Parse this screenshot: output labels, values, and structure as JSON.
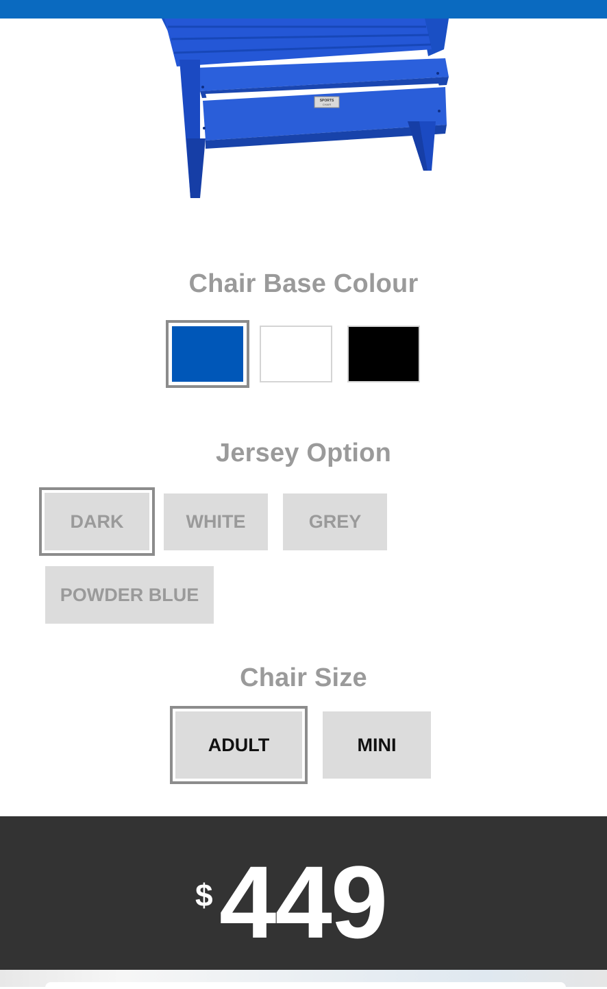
{
  "header": {
    "accent_color": "#0a6ac0"
  },
  "product_image": {
    "description": "blue-chair-image",
    "badge_text": "SPORTS CHAIR"
  },
  "base_colour": {
    "title": "Chair Base Colour",
    "options": [
      {
        "name": "blue",
        "color": "#0057b8",
        "selected": true
      },
      {
        "name": "white",
        "color": "#ffffff",
        "selected": false
      },
      {
        "name": "black",
        "color": "#000000",
        "selected": false
      }
    ]
  },
  "jersey": {
    "title": "Jersey Option",
    "options": [
      {
        "label": "DARK",
        "selected": true
      },
      {
        "label": "WHITE",
        "selected": false
      },
      {
        "label": "GREY",
        "selected": false
      },
      {
        "label": "POWDER BLUE",
        "selected": false
      }
    ]
  },
  "size": {
    "title": "Chair Size",
    "options": [
      {
        "label": "ADULT",
        "selected": true
      },
      {
        "label": "MINI",
        "selected": false
      }
    ]
  },
  "price": {
    "currency": "$",
    "amount": "449"
  }
}
